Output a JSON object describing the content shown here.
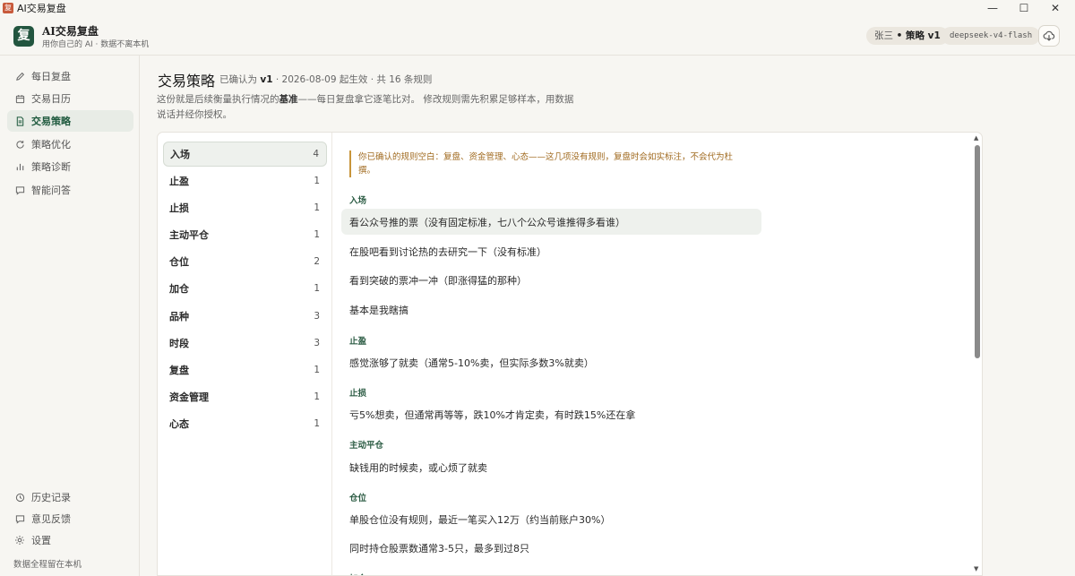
{
  "window": {
    "title": "AI交易复盘",
    "icon_glyph": "复",
    "controls": {
      "minimize": "—",
      "maximize": "☐",
      "close": "✕"
    }
  },
  "header": {
    "logo_glyph": "复",
    "brand_title": "AI交易复盘",
    "brand_subtitle": "用你自己的 AI · 数据不离本机",
    "user_name": "张三",
    "user_sep": " • ",
    "strategy_label": "策略 v1",
    "model": "deepseek-v4-flash",
    "cloud_icon": "cloud-download-icon"
  },
  "sidebar": {
    "items": [
      {
        "label": "每日复盘",
        "icon": "pen-icon"
      },
      {
        "label": "交易日历",
        "icon": "calendar-icon"
      },
      {
        "label": "交易策略",
        "icon": "document-icon",
        "active": true
      },
      {
        "label": "策略优化",
        "icon": "refresh-icon"
      },
      {
        "label": "策略诊断",
        "icon": "bar-chart-icon"
      },
      {
        "label": "智能问答",
        "icon": "chat-icon"
      }
    ],
    "bottom_items": [
      {
        "label": "历史记录",
        "icon": "clock-icon"
      },
      {
        "label": "意见反馈",
        "icon": "feedback-icon"
      },
      {
        "label": "设置",
        "icon": "gear-icon"
      }
    ],
    "footer": "数据全程留在本机"
  },
  "page": {
    "title": "交易策略",
    "meta_prefix": "已确认为 ",
    "meta_version": "v1",
    "meta_suffix": " · 2026-08-09 起生效 · 共 16 条规则",
    "desc_part1": "这份就是后续衡量执行情况的",
    "desc_bold": "基准",
    "desc_part2": "——每日复盘拿它逐笔比对。 修改规则需先积累足够样本，用数据说话并经你授权。"
  },
  "categories": [
    {
      "name": "入场",
      "count": "4",
      "active": true
    },
    {
      "name": "止盈",
      "count": "1"
    },
    {
      "name": "止损",
      "count": "1"
    },
    {
      "name": "主动平仓",
      "count": "1"
    },
    {
      "name": "仓位",
      "count": "2"
    },
    {
      "name": "加仓",
      "count": "1"
    },
    {
      "name": "品种",
      "count": "3"
    },
    {
      "name": "时段",
      "count": "3"
    },
    {
      "name": "复盘",
      "count": "1"
    },
    {
      "name": "资金管理",
      "count": "1"
    },
    {
      "name": "心态",
      "count": "1"
    }
  ],
  "notice": "你已确认的规则空白：复盘、资金管理、心态——这几项没有规则，复盘时会如实标注，不会代为杜撰。",
  "sections": [
    {
      "title": "入场",
      "rules": [
        "看公众号推的票（没有固定标准，七八个公众号谁推得多看谁）",
        "在股吧看到讨论热的去研究一下（没有标准）",
        "看到突破的票冲一冲（即涨得猛的那种）",
        "基本是我瞎搞"
      ]
    },
    {
      "title": "止盈",
      "rules": [
        "感觉涨够了就卖（通常5-10%卖，但实际多数3%就卖）"
      ]
    },
    {
      "title": "止损",
      "rules": [
        "亏5%想卖，但通常再等等，跌10%才肯定卖，有时跌15%还在拿"
      ]
    },
    {
      "title": "主动平仓",
      "rules": [
        "缺钱用的时候卖，或心烦了就卖"
      ]
    },
    {
      "title": "仓位",
      "rules": [
        "单股仓位没有规则，最近一笔买入12万（约当前账户30%）",
        "同时持仓股票数通常3-5只，最多到过8只"
      ]
    },
    {
      "title": "加仓",
      "rules": []
    }
  ]
}
